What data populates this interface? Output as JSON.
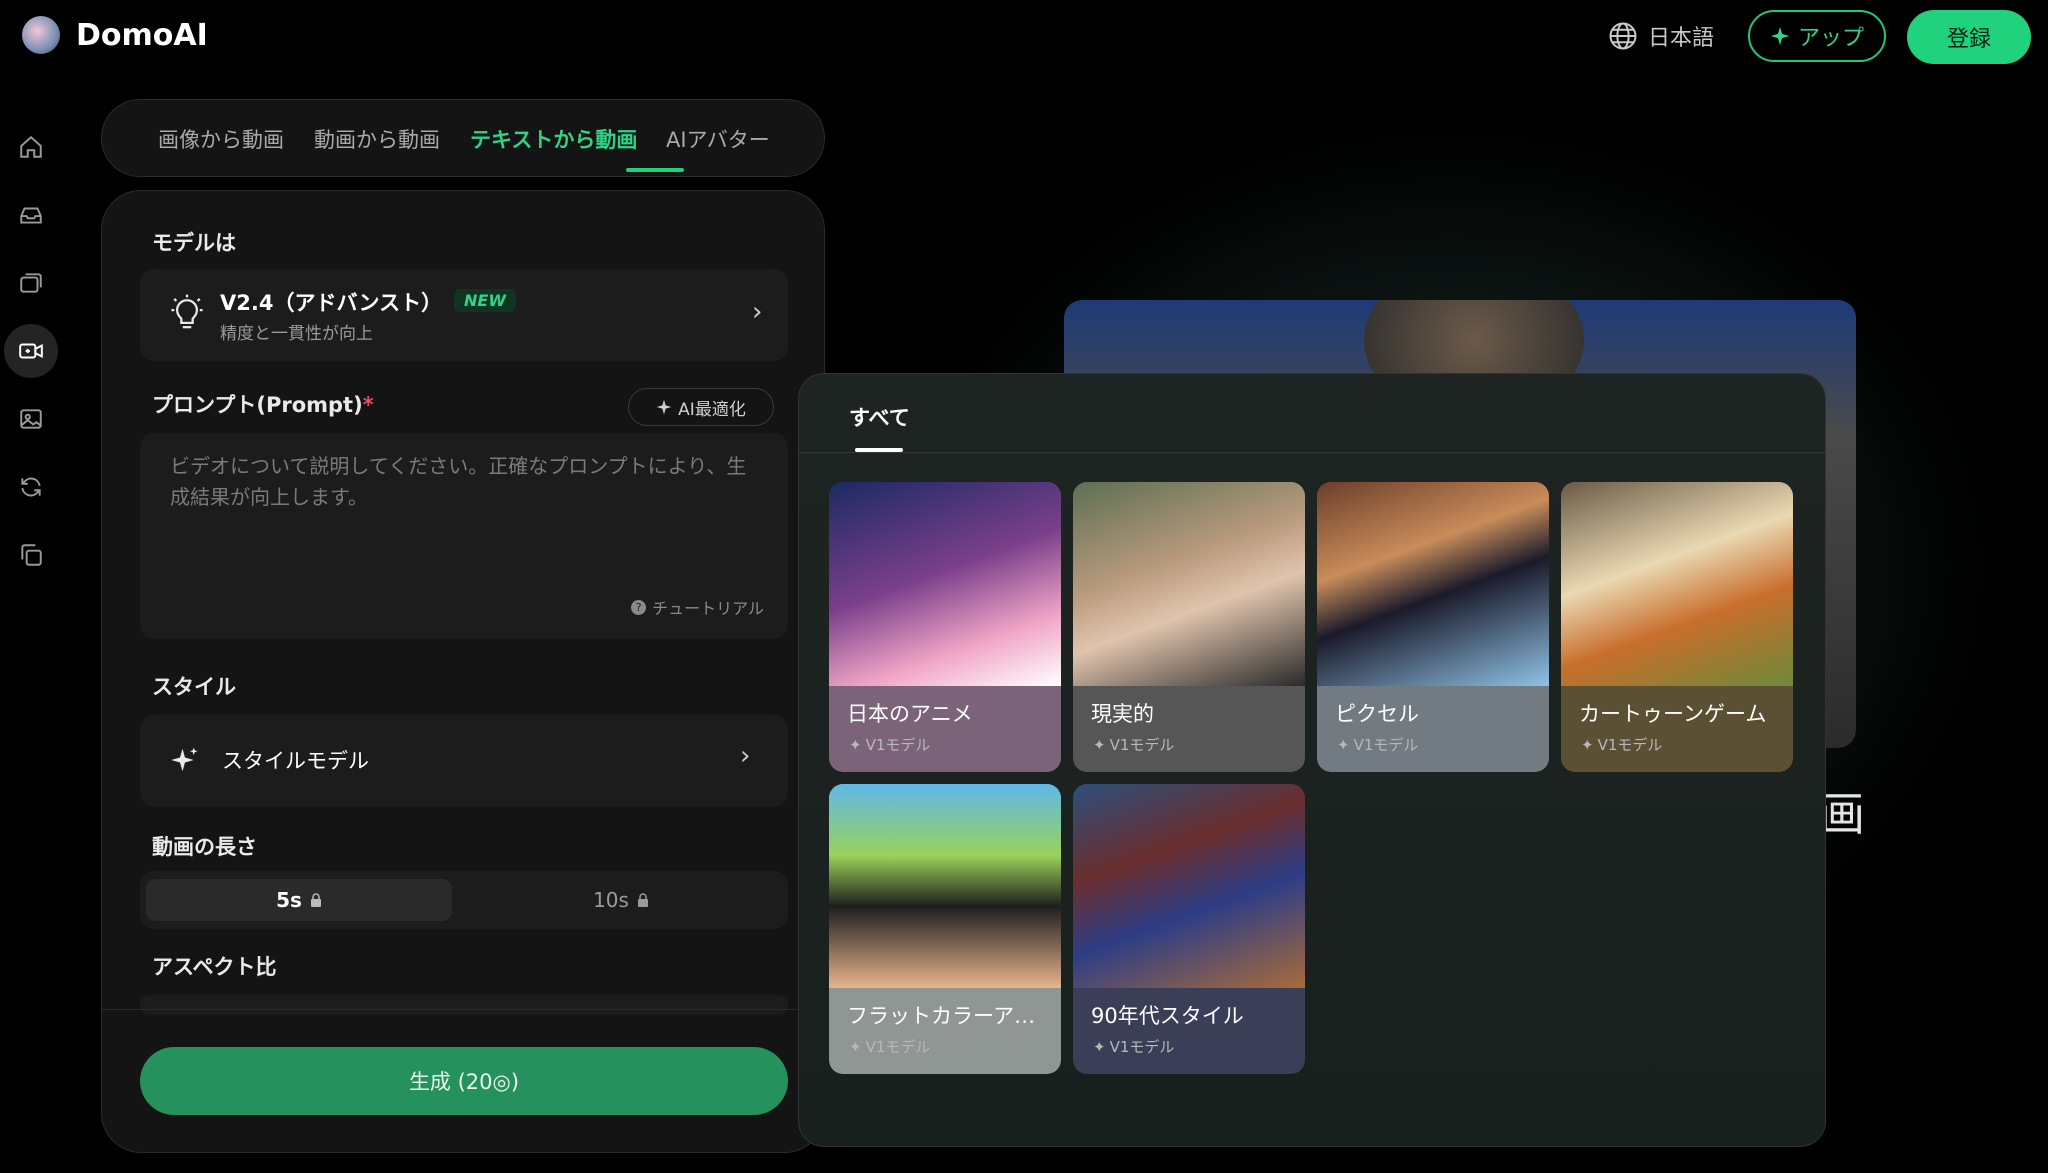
{
  "header": {
    "app_name": "DomoAI",
    "language": "日本語",
    "app_button": "アップ",
    "register_button": "登録"
  },
  "sidebar": {
    "items": [
      {
        "icon": "home-icon"
      },
      {
        "icon": "inbox-icon"
      },
      {
        "icon": "gallery-icon"
      },
      {
        "icon": "video-icon",
        "active": true
      },
      {
        "icon": "image-icon"
      },
      {
        "icon": "refresh-icon"
      },
      {
        "icon": "copy-icon"
      }
    ]
  },
  "tabs": [
    {
      "label": "画像から動画"
    },
    {
      "label": "動画から動画"
    },
    {
      "label": "テキストから動画",
      "active": true
    },
    {
      "label": "AIアバター"
    }
  ],
  "panel": {
    "model_label": "モデルは",
    "model_name": "V2.4（アドバンスト）",
    "model_badge": "NEW",
    "model_desc": "精度と一貫性が向上",
    "prompt_label": "プロンプト(Prompt)",
    "required_mark": "*",
    "ai_optimize": "AI最適化",
    "prompt_placeholder": "ビデオについて説明してください。正確なプロンプトにより、生成結果が向上します。",
    "tutorial": "チュートリアル",
    "style_label": "スタイル",
    "style_model": "スタイルモデル",
    "duration_label": "動画の長さ",
    "durations": [
      "5s",
      "10s"
    ],
    "aspect_label": "アスペクト比",
    "generate_button": "生成 (20◎)"
  },
  "popup": {
    "tab_all": "すべて",
    "styles": [
      {
        "name": "日本のアニメ",
        "model": "V1モデル"
      },
      {
        "name": "現実的",
        "model": "V1モデル"
      },
      {
        "name": "ピクセル",
        "model": "V1モデル"
      },
      {
        "name": "カートゥーンゲーム",
        "model": "V1モデル"
      },
      {
        "name": "フラットカラーア…",
        "model": "V1モデル"
      },
      {
        "name": "90年代スタイル",
        "model": "V1モデル"
      }
    ]
  },
  "preview": {
    "partial_text": "画"
  },
  "colors": {
    "accent": "#1fd27b",
    "generate": "#25915c"
  }
}
